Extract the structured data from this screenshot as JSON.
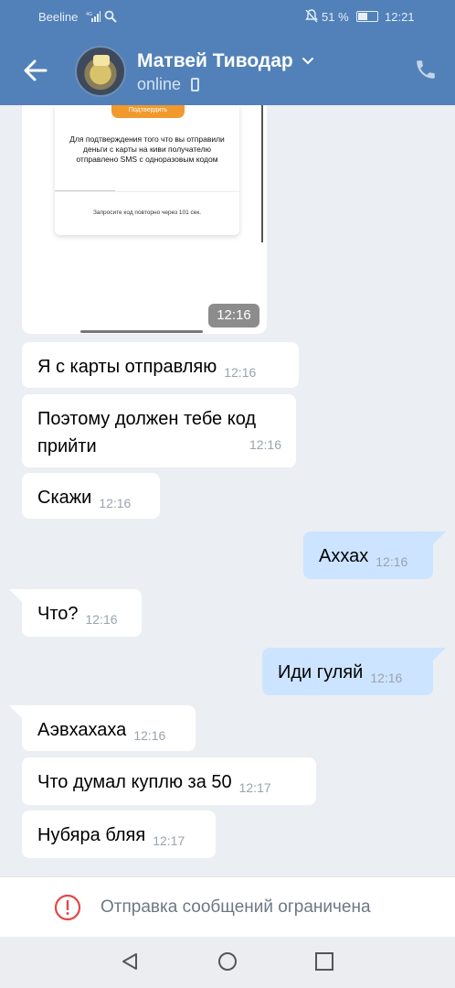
{
  "status_bar": {
    "carrier": "Beeline",
    "network": "4G",
    "battery_percent": "51 %",
    "battery_level": 0.51,
    "time": "12:21"
  },
  "header": {
    "contact_name": "Матвей Тиводар",
    "presence": "online",
    "icons": [
      "back-arrow-icon",
      "chevron-down-icon",
      "mobile-icon",
      "phone-icon"
    ]
  },
  "photo_message": {
    "button_text": "Подтвердить",
    "body_text": "Для подтверждения того что вы отправили деньги с карты на киви получателю отправлено SMS с одноразовым кодом",
    "resend_text": "Запросите код повторно через 101 сек.",
    "time": "12:16"
  },
  "messages": [
    {
      "direction": "in",
      "text": "Я с карты отправляю",
      "time": "12:16"
    },
    {
      "direction": "in",
      "text": "Поэтому должен тебе код прийти",
      "time": "12:16"
    },
    {
      "direction": "in",
      "text": "Скажи",
      "time": "12:16"
    },
    {
      "direction": "out",
      "text": "Аххах",
      "time": "12:16"
    },
    {
      "direction": "in",
      "text": "Что?",
      "time": "12:16"
    },
    {
      "direction": "out",
      "text": "Иди гуляй",
      "time": "12:16"
    },
    {
      "direction": "in",
      "text": "Аэвхахаха",
      "time": "12:16"
    },
    {
      "direction": "in",
      "text": "Что думал куплю за 50",
      "time": "12:17"
    },
    {
      "direction": "in",
      "text": "Нубяра бляя",
      "time": "12:17"
    }
  ],
  "restriction": {
    "text": "Отправка сообщений ограничена",
    "icon": "warning-circle-icon"
  },
  "colors": {
    "header": "#5181b8",
    "background": "#ebeef3",
    "outgoing_bubble": "#cce4ff",
    "incoming_bubble": "#ffffff",
    "warning": "#e64646"
  }
}
